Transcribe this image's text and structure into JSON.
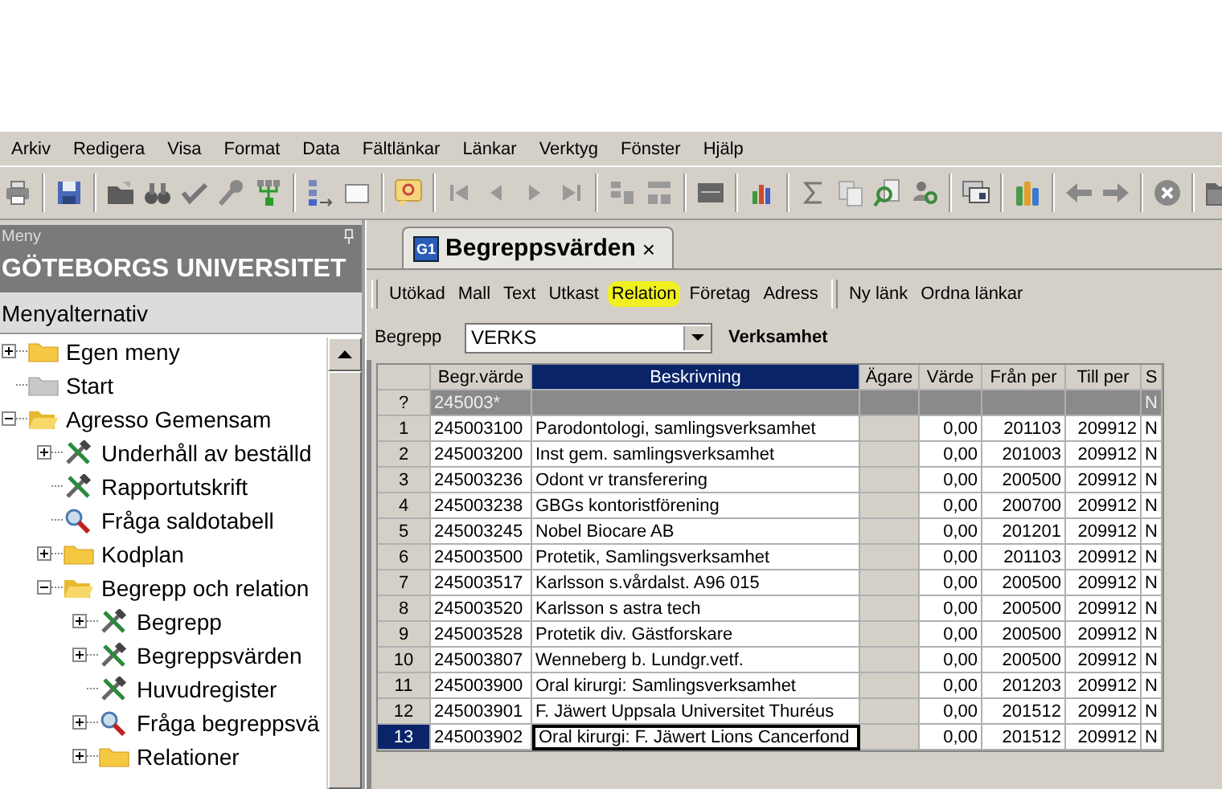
{
  "menu_bar": [
    "Arkiv",
    "Redigera",
    "Visa",
    "Format",
    "Data",
    "Fältlänkar",
    "Länkar",
    "Verktyg",
    "Fönster",
    "Hjälp"
  ],
  "sidebar": {
    "caption": "Meny",
    "organization": "GÖTEBORGS UNIVERSITET",
    "section": "Menyalternativ",
    "tree": [
      {
        "label": "Egen meny",
        "kind": "folder",
        "expanded": false
      },
      {
        "label": "Start",
        "kind": "grey-folder"
      },
      {
        "label": "Agresso Gemensam",
        "kind": "folder",
        "expanded": true,
        "children": [
          {
            "label": "Underhåll av beställd",
            "kind": "tools",
            "expanded": false
          },
          {
            "label": "Rapportutskrift",
            "kind": "tools"
          },
          {
            "label": "Fråga saldotabell",
            "kind": "search"
          },
          {
            "label": "Kodplan",
            "kind": "folder",
            "expanded": false
          },
          {
            "label": "Begrepp och relation",
            "kind": "folder",
            "expanded": true,
            "children": [
              {
                "label": "Begrepp",
                "kind": "tools",
                "expanded": false
              },
              {
                "label": "Begreppsvärden",
                "kind": "tools",
                "expanded": false
              },
              {
                "label": "Huvudregister",
                "kind": "tools"
              },
              {
                "label": "Fråga begreppsvä",
                "kind": "search",
                "expanded": false
              },
              {
                "label": "Relationer",
                "kind": "folder",
                "expanded": false
              }
            ]
          }
        ]
      }
    ]
  },
  "document_tab": {
    "badge": "G1",
    "title": "Begreppsvärden",
    "close": "×"
  },
  "action_bar": [
    {
      "label": "Utökad",
      "highlighted": false
    },
    {
      "label": "Mall",
      "highlighted": false
    },
    {
      "label": "Text",
      "highlighted": false
    },
    {
      "label": "Utkast",
      "highlighted": false
    },
    {
      "label": "Relation",
      "highlighted": true
    },
    {
      "label": "Företag",
      "highlighted": false
    },
    {
      "label": "Adress",
      "highlighted": false
    }
  ],
  "link_bar": [
    "Ny länk",
    "Ordna länkar"
  ],
  "concept": {
    "label": "Begrepp",
    "value": "VERKS",
    "name": "Verksamhet"
  },
  "table": {
    "columns": [
      {
        "label": "Begr.värde",
        "selected": false
      },
      {
        "label": "Beskrivning",
        "selected": true
      },
      {
        "label": "Ägare",
        "selected": false
      },
      {
        "label": "Värde",
        "selected": false
      },
      {
        "label": "Från per",
        "selected": false
      },
      {
        "label": "Till per",
        "selected": false
      },
      {
        "label": "S",
        "selected": false
      }
    ],
    "filter": {
      "marker": "?",
      "value": "245003*",
      "s": "N"
    },
    "rows": [
      {
        "number": "1",
        "value": "245003100",
        "description": "Parodontologi, samlingsverksamhet",
        "amount": "0,00",
        "from": "201103",
        "to": "209912",
        "s": "N",
        "selected": false
      },
      {
        "number": "2",
        "value": "245003200",
        "description": "Inst gem. samlingsverksamhet",
        "amount": "0,00",
        "from": "201003",
        "to": "209912",
        "s": "N",
        "selected": false
      },
      {
        "number": "3",
        "value": "245003236",
        "description": "Odont vr transferering",
        "amount": "0,00",
        "from": "200500",
        "to": "209912",
        "s": "N",
        "selected": false
      },
      {
        "number": "4",
        "value": "245003238",
        "description": "GBGs kontoristförening",
        "amount": "0,00",
        "from": "200700",
        "to": "209912",
        "s": "N",
        "selected": false
      },
      {
        "number": "5",
        "value": "245003245",
        "description": "Nobel Biocare AB",
        "amount": "0,00",
        "from": "201201",
        "to": "209912",
        "s": "N",
        "selected": false
      },
      {
        "number": "6",
        "value": "245003500",
        "description": "Protetik, Samlingsverksamhet",
        "amount": "0,00",
        "from": "201103",
        "to": "209912",
        "s": "N",
        "selected": false
      },
      {
        "number": "7",
        "value": "245003517",
        "description": "Karlsson s.vårdalst. A96 015",
        "amount": "0,00",
        "from": "200500",
        "to": "209912",
        "s": "N",
        "selected": false
      },
      {
        "number": "8",
        "value": "245003520",
        "description": "Karlsson s astra tech",
        "amount": "0,00",
        "from": "200500",
        "to": "209912",
        "s": "N",
        "selected": false
      },
      {
        "number": "9",
        "value": "245003528",
        "description": "Protetik div. Gästforskare",
        "amount": "0,00",
        "from": "200500",
        "to": "209912",
        "s": "N",
        "selected": false
      },
      {
        "number": "10",
        "value": "245003807",
        "description": "Wenneberg b. Lundgr.vetf.",
        "amount": "0,00",
        "from": "200500",
        "to": "209912",
        "s": "N",
        "selected": false
      },
      {
        "number": "11",
        "value": "245003900",
        "description": "Oral kirurgi: Samlingsverksamhet",
        "amount": "0,00",
        "from": "201203",
        "to": "209912",
        "s": "N",
        "selected": false
      },
      {
        "number": "12",
        "value": "245003901",
        "description": "F. Jäwert Uppsala Universitet Thuréus",
        "amount": "0,00",
        "from": "201512",
        "to": "209912",
        "s": "N",
        "selected": false
      },
      {
        "number": "13",
        "value": "245003902",
        "description": "Oral kirurgi: F. Jäwert Lions Cancerfond",
        "amount": "0,00",
        "from": "201512",
        "to": "209912",
        "s": "N",
        "selected": true
      }
    ]
  }
}
